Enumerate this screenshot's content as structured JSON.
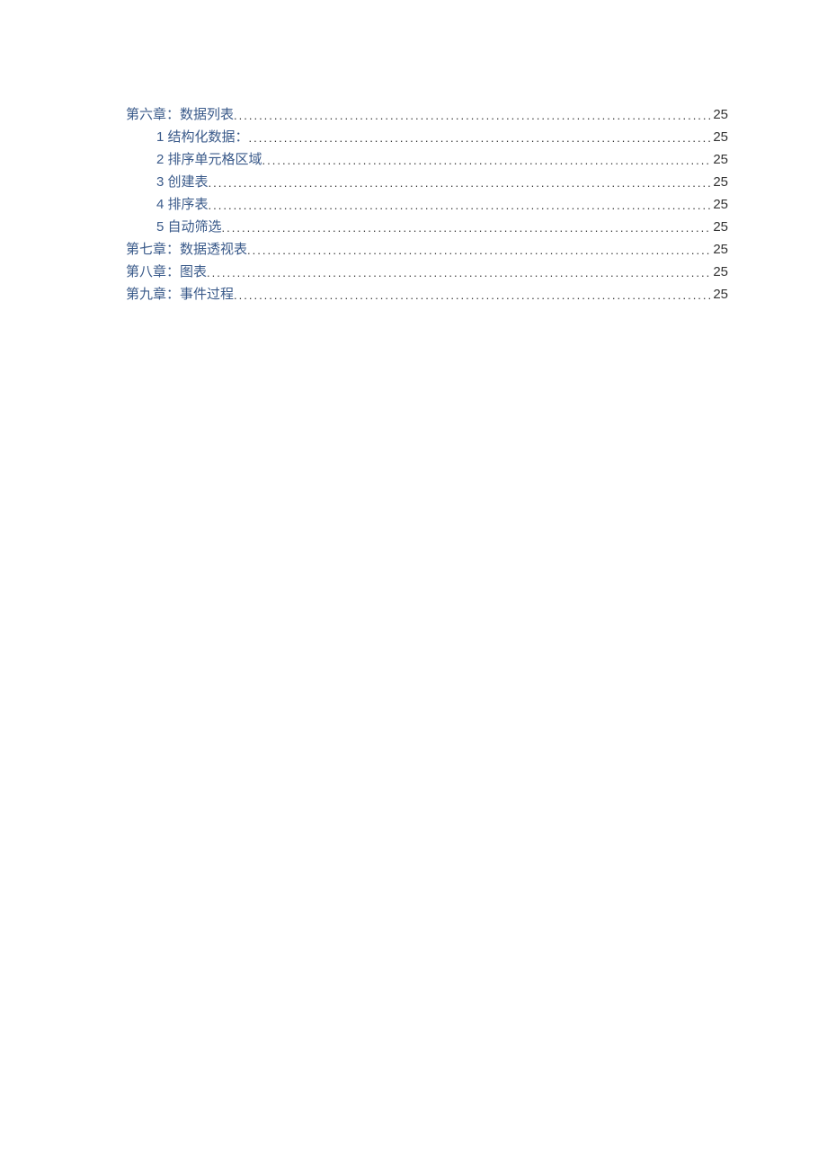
{
  "toc": [
    {
      "level": 1,
      "title": "第六章：数据列表",
      "page": "25",
      "isLink": true
    },
    {
      "level": 2,
      "title": "1 结构化数据：",
      "page": "25",
      "isLink": true
    },
    {
      "level": 2,
      "title": "2 排序单元格区域",
      "page": "25",
      "isLink": true
    },
    {
      "level": 2,
      "title": "3 创建表",
      "page": "25",
      "isLink": true
    },
    {
      "level": 2,
      "title": "4 排序表",
      "page": "25",
      "isLink": true
    },
    {
      "level": 2,
      "title": "5 自动筛选",
      "page": "25",
      "isLink": true
    },
    {
      "level": 1,
      "title": "第七章：数据透视表",
      "page": "25",
      "isLink": true
    },
    {
      "level": 1,
      "title": "第八章：图表",
      "page": "25",
      "isLink": true
    },
    {
      "level": 1,
      "title": "第九章：事件过程",
      "page": "25",
      "isLink": true
    }
  ]
}
